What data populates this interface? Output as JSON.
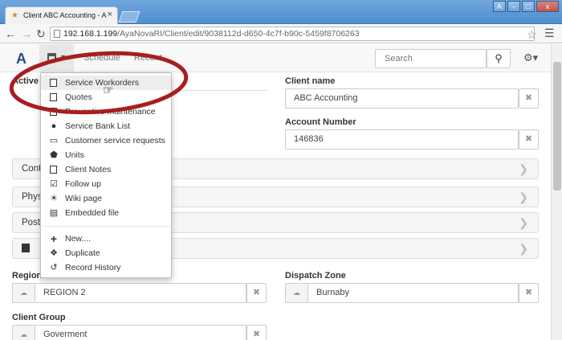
{
  "browser": {
    "tab_title": "Client ABC Accounting - A",
    "tab_close": "×",
    "url_host": "192.168.1.199",
    "url_path": "/AyaNovaRI/Client/edit/9038112d-d650-4c7f-b90c-5459f8706263",
    "window_controls": [
      "A",
      "–",
      "□",
      "x"
    ]
  },
  "navbar": {
    "logo": "A",
    "links": [
      "Schedule",
      "Recent..."
    ],
    "search_placeholder": "Search"
  },
  "dropdown": {
    "items": [
      {
        "label": "Service Workorders",
        "icon": "workorder-icon"
      },
      {
        "label": "Quotes",
        "icon": "quote-icon"
      },
      {
        "label": "Preventive maintenance",
        "icon": "pm-icon"
      },
      {
        "label": "Service Bank List",
        "icon": "piggy-bank-icon"
      },
      {
        "label": "Customer service requests",
        "icon": "laptop-icon"
      },
      {
        "label": "Units",
        "icon": "unit-icon"
      },
      {
        "label": "Client Notes",
        "icon": "note-icon"
      },
      {
        "label": "Follow up",
        "icon": "follow-up-icon"
      },
      {
        "label": "Wiki page",
        "icon": "wiki-icon"
      },
      {
        "label": "Embedded file",
        "icon": "file-icon"
      },
      {
        "label": "New....",
        "icon": "plus-icon"
      },
      {
        "label": "Duplicate",
        "icon": "duplicate-icon"
      },
      {
        "label": "Record History",
        "icon": "history-icon"
      }
    ]
  },
  "form": {
    "active_label": "Active",
    "client_name_label": "Client name",
    "client_name_value": "ABC Accounting",
    "account_number_label": "Account Number",
    "account_number_value": "146836",
    "panels": [
      "Cont",
      "Phys",
      "Post"
    ],
    "region_label": "Region",
    "region_value": "REGION 2",
    "dispatch_zone_label": "Dispatch Zone",
    "dispatch_zone_value": "Burnaby",
    "client_group_label": "Client Group",
    "client_group_value": "Goverment"
  }
}
